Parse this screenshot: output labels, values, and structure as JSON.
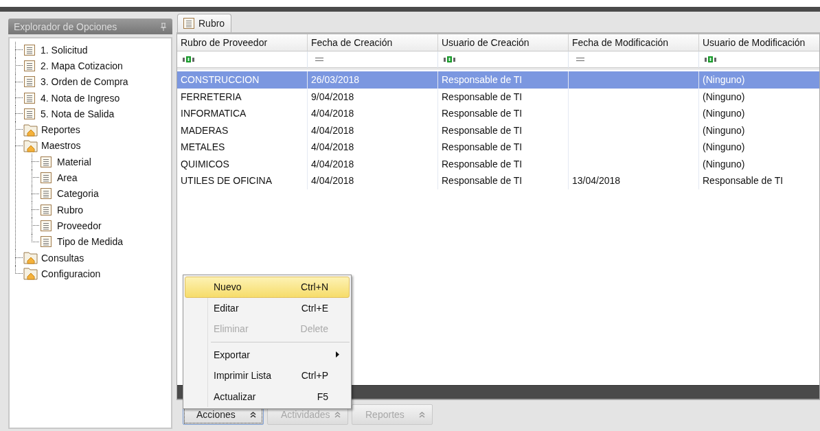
{
  "explorer": {
    "title": "Explorador de Opciones",
    "items": [
      {
        "label": "1. Solicitud",
        "kind": "document"
      },
      {
        "label": "2. Mapa Cotizacion",
        "kind": "document"
      },
      {
        "label": "3. Orden de Compra",
        "kind": "document"
      },
      {
        "label": "4. Nota de Ingreso",
        "kind": "document"
      },
      {
        "label": "5. Nota de Salida",
        "kind": "document"
      },
      {
        "label": "Reportes",
        "kind": "folder"
      },
      {
        "label": "Maestros",
        "kind": "folder",
        "children": [
          {
            "label": "Material",
            "kind": "document"
          },
          {
            "label": "Area",
            "kind": "document"
          },
          {
            "label": "Categoria",
            "kind": "document"
          },
          {
            "label": "Rubro",
            "kind": "document"
          },
          {
            "label": "Proveedor",
            "kind": "document"
          },
          {
            "label": "Tipo de Medida",
            "kind": "document"
          }
        ]
      },
      {
        "label": "Consultas",
        "kind": "folder"
      },
      {
        "label": "Configuracion",
        "kind": "folder"
      }
    ]
  },
  "tabs": [
    {
      "label": "Rubro",
      "selected": true
    }
  ],
  "table": {
    "columns": [
      {
        "label": "Rubro de Proveedor",
        "filter": {
          "kind": "text"
        }
      },
      {
        "label": "Fecha de Creación",
        "filter": {
          "kind": "equals"
        }
      },
      {
        "label": "Usuario de Creación",
        "filter": {
          "kind": "text"
        }
      },
      {
        "label": "Fecha de Modificación",
        "filter": {
          "kind": "equals"
        }
      },
      {
        "label": "Usuario de Modificación",
        "filter": {
          "kind": "text"
        }
      }
    ],
    "rows": [
      {
        "cells": [
          "CONSTRUCCION",
          "26/03/2018",
          "Responsable de TI",
          "",
          "(Ninguno)"
        ],
        "selected": true
      },
      {
        "cells": [
          "FERRETERIA",
          "9/04/2018",
          "Responsable de TI",
          "",
          "(Ninguno)"
        ],
        "selected": false
      },
      {
        "cells": [
          "INFORMATICA",
          "4/04/2018",
          "Responsable de TI",
          "",
          "(Ninguno)"
        ],
        "selected": false
      },
      {
        "cells": [
          "MADERAS",
          "4/04/2018",
          "Responsable de TI",
          "",
          "(Ninguno)"
        ],
        "selected": false
      },
      {
        "cells": [
          "METALES",
          "4/04/2018",
          "Responsable de TI",
          "",
          "(Ninguno)"
        ],
        "selected": false
      },
      {
        "cells": [
          "QUIMICOS",
          "4/04/2018",
          "Responsable de TI",
          "",
          "(Ninguno)"
        ],
        "selected": false
      },
      {
        "cells": [
          "UTILES DE OFICINA",
          "4/04/2018",
          "Responsable de TI",
          "13/04/2018",
          "Responsable de TI"
        ],
        "selected": false
      }
    ]
  },
  "context_menu": {
    "items": [
      {
        "kind": "item",
        "label": "Nuevo",
        "shortcut": "Ctrl+N",
        "selected": true,
        "disabled": false
      },
      {
        "kind": "item",
        "label": "Editar",
        "shortcut": "Ctrl+E",
        "selected": false,
        "disabled": false
      },
      {
        "kind": "item",
        "label": "Eliminar",
        "shortcut": "Delete",
        "selected": false,
        "disabled": true
      },
      {
        "kind": "separator"
      },
      {
        "kind": "submenu",
        "label": "Exportar",
        "selected": false,
        "disabled": false
      },
      {
        "kind": "item",
        "label": "Imprimir Lista",
        "shortcut": "Ctrl+P",
        "selected": false,
        "disabled": false
      },
      {
        "kind": "item",
        "label": "Actualizar",
        "shortcut": "F5",
        "selected": false,
        "disabled": false
      }
    ]
  },
  "bottom_bar": {
    "buttons": [
      {
        "label": "Acciones",
        "selected": true,
        "disabled": false
      },
      {
        "label": "Actividades",
        "selected": false,
        "disabled": true
      },
      {
        "label": "Reportes",
        "selected": false,
        "disabled": true
      }
    ]
  }
}
